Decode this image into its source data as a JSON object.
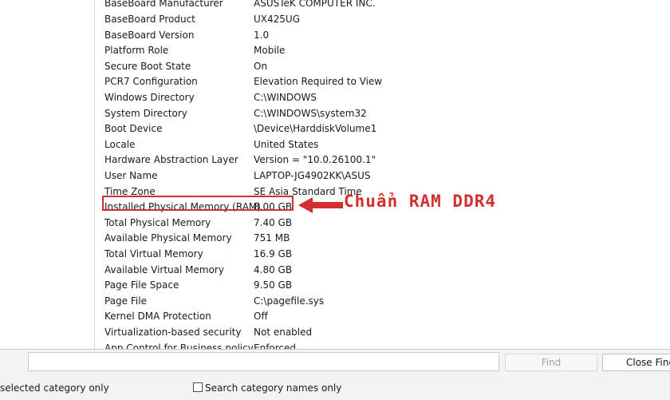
{
  "rows": [
    {
      "item": "BaseBoard Manufacturer",
      "value": "ASUSTeK COMPUTER INC."
    },
    {
      "item": "BaseBoard Product",
      "value": "UX425UG"
    },
    {
      "item": "BaseBoard Version",
      "value": "1.0"
    },
    {
      "item": "Platform Role",
      "value": "Mobile"
    },
    {
      "item": "Secure Boot State",
      "value": "On"
    },
    {
      "item": "PCR7 Configuration",
      "value": "Elevation Required to View"
    },
    {
      "item": "Windows Directory",
      "value": "C:\\WINDOWS"
    },
    {
      "item": "System Directory",
      "value": "C:\\WINDOWS\\system32"
    },
    {
      "item": "Boot Device",
      "value": "\\Device\\HarddiskVolume1"
    },
    {
      "item": "Locale",
      "value": "United States"
    },
    {
      "item": "Hardware Abstraction Layer",
      "value": "Version = \"10.0.26100.1\""
    },
    {
      "item": "User Name",
      "value": "LAPTOP-JG4902KK\\ASUS"
    },
    {
      "item": "Time Zone",
      "value": "SE Asia Standard Time"
    },
    {
      "item": "Installed Physical Memory (RAM)",
      "value": "8.00 GB"
    },
    {
      "item": "Total Physical Memory",
      "value": "7.40 GB"
    },
    {
      "item": "Available Physical Memory",
      "value": "751 MB"
    },
    {
      "item": "Total Virtual Memory",
      "value": "16.9 GB"
    },
    {
      "item": "Available Virtual Memory",
      "value": "4.80 GB"
    },
    {
      "item": "Page File Space",
      "value": "9.50 GB"
    },
    {
      "item": "Page File",
      "value": "C:\\pagefile.sys"
    },
    {
      "item": "Kernel DMA Protection",
      "value": "Off"
    },
    {
      "item": "Virtualization-based security",
      "value": "Not enabled"
    },
    {
      "item": "App Control for Business policy",
      "value": "Enforced"
    }
  ],
  "annotation": {
    "text": "Chuẩn RAM DDR4",
    "color": "#d32f2f"
  },
  "find_bar": {
    "find_label": "Find",
    "close_find_label": "Close Find",
    "selected_category_label": "selected category only",
    "search_category_names_label": "Search category names only"
  }
}
